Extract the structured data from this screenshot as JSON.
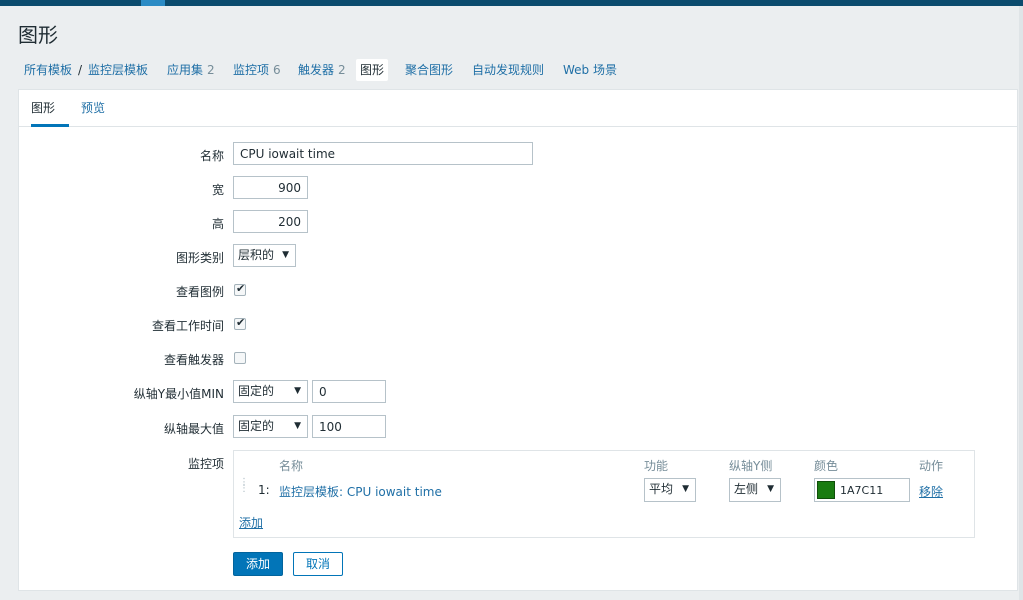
{
  "page": {
    "title": "图形"
  },
  "breadcrumb": [
    {
      "label": "所有模板",
      "count": ""
    },
    {
      "label": "监控层模板",
      "count": ""
    },
    {
      "label": "应用集",
      "count": "2"
    },
    {
      "label": "监控项",
      "count": "6"
    },
    {
      "label": "触发器",
      "count": "2"
    },
    {
      "label": "图形",
      "count": ""
    },
    {
      "label": "聚合图形",
      "count": ""
    },
    {
      "label": "自动发现规则",
      "count": ""
    },
    {
      "label": "Web 场景",
      "count": ""
    }
  ],
  "breadcrumb_separator": "/",
  "tabs": [
    {
      "label": "图形"
    },
    {
      "label": "预览"
    }
  ],
  "form": {
    "name_label": "名称",
    "name_value": "CPU iowait time",
    "width_label": "宽",
    "width_value": "900",
    "height_label": "高",
    "height_value": "200",
    "type_label": "图形类别",
    "type_value": "层积的",
    "show_legend_label": "查看图例",
    "show_legend": true,
    "show_worktime_label": "查看工作时间",
    "show_worktime": true,
    "show_triggers_label": "查看触发器",
    "show_triggers": false,
    "ymin_label": "纵轴Y最小值MIN",
    "ymin_type": "固定的",
    "ymin_value": "0",
    "ymax_label": "纵轴最大值",
    "ymax_type": "固定的",
    "ymax_value": "100",
    "items_label": "监控项"
  },
  "items_table": {
    "headers": {
      "name": "名称",
      "function": "功能",
      "yaxis": "纵轴Y侧",
      "color": "颜色",
      "action": "动作"
    },
    "rows": [
      {
        "num": "1:",
        "name": "监控层模板: CPU iowait time",
        "function": "平均",
        "yaxis": "左侧",
        "color": "1A7C11",
        "action": "移除"
      }
    ],
    "add_label": "添加"
  },
  "buttons": {
    "add": "添加",
    "cancel": "取消"
  },
  "icons": {
    "check": "check-icon",
    "caret": "caret-down-icon",
    "drag": "drag-handle-icon"
  },
  "colors": {
    "accent": "#0275b8",
    "link": "#1f6fa6",
    "topbar": "#0b4b6e",
    "series": "#1A7C11"
  }
}
